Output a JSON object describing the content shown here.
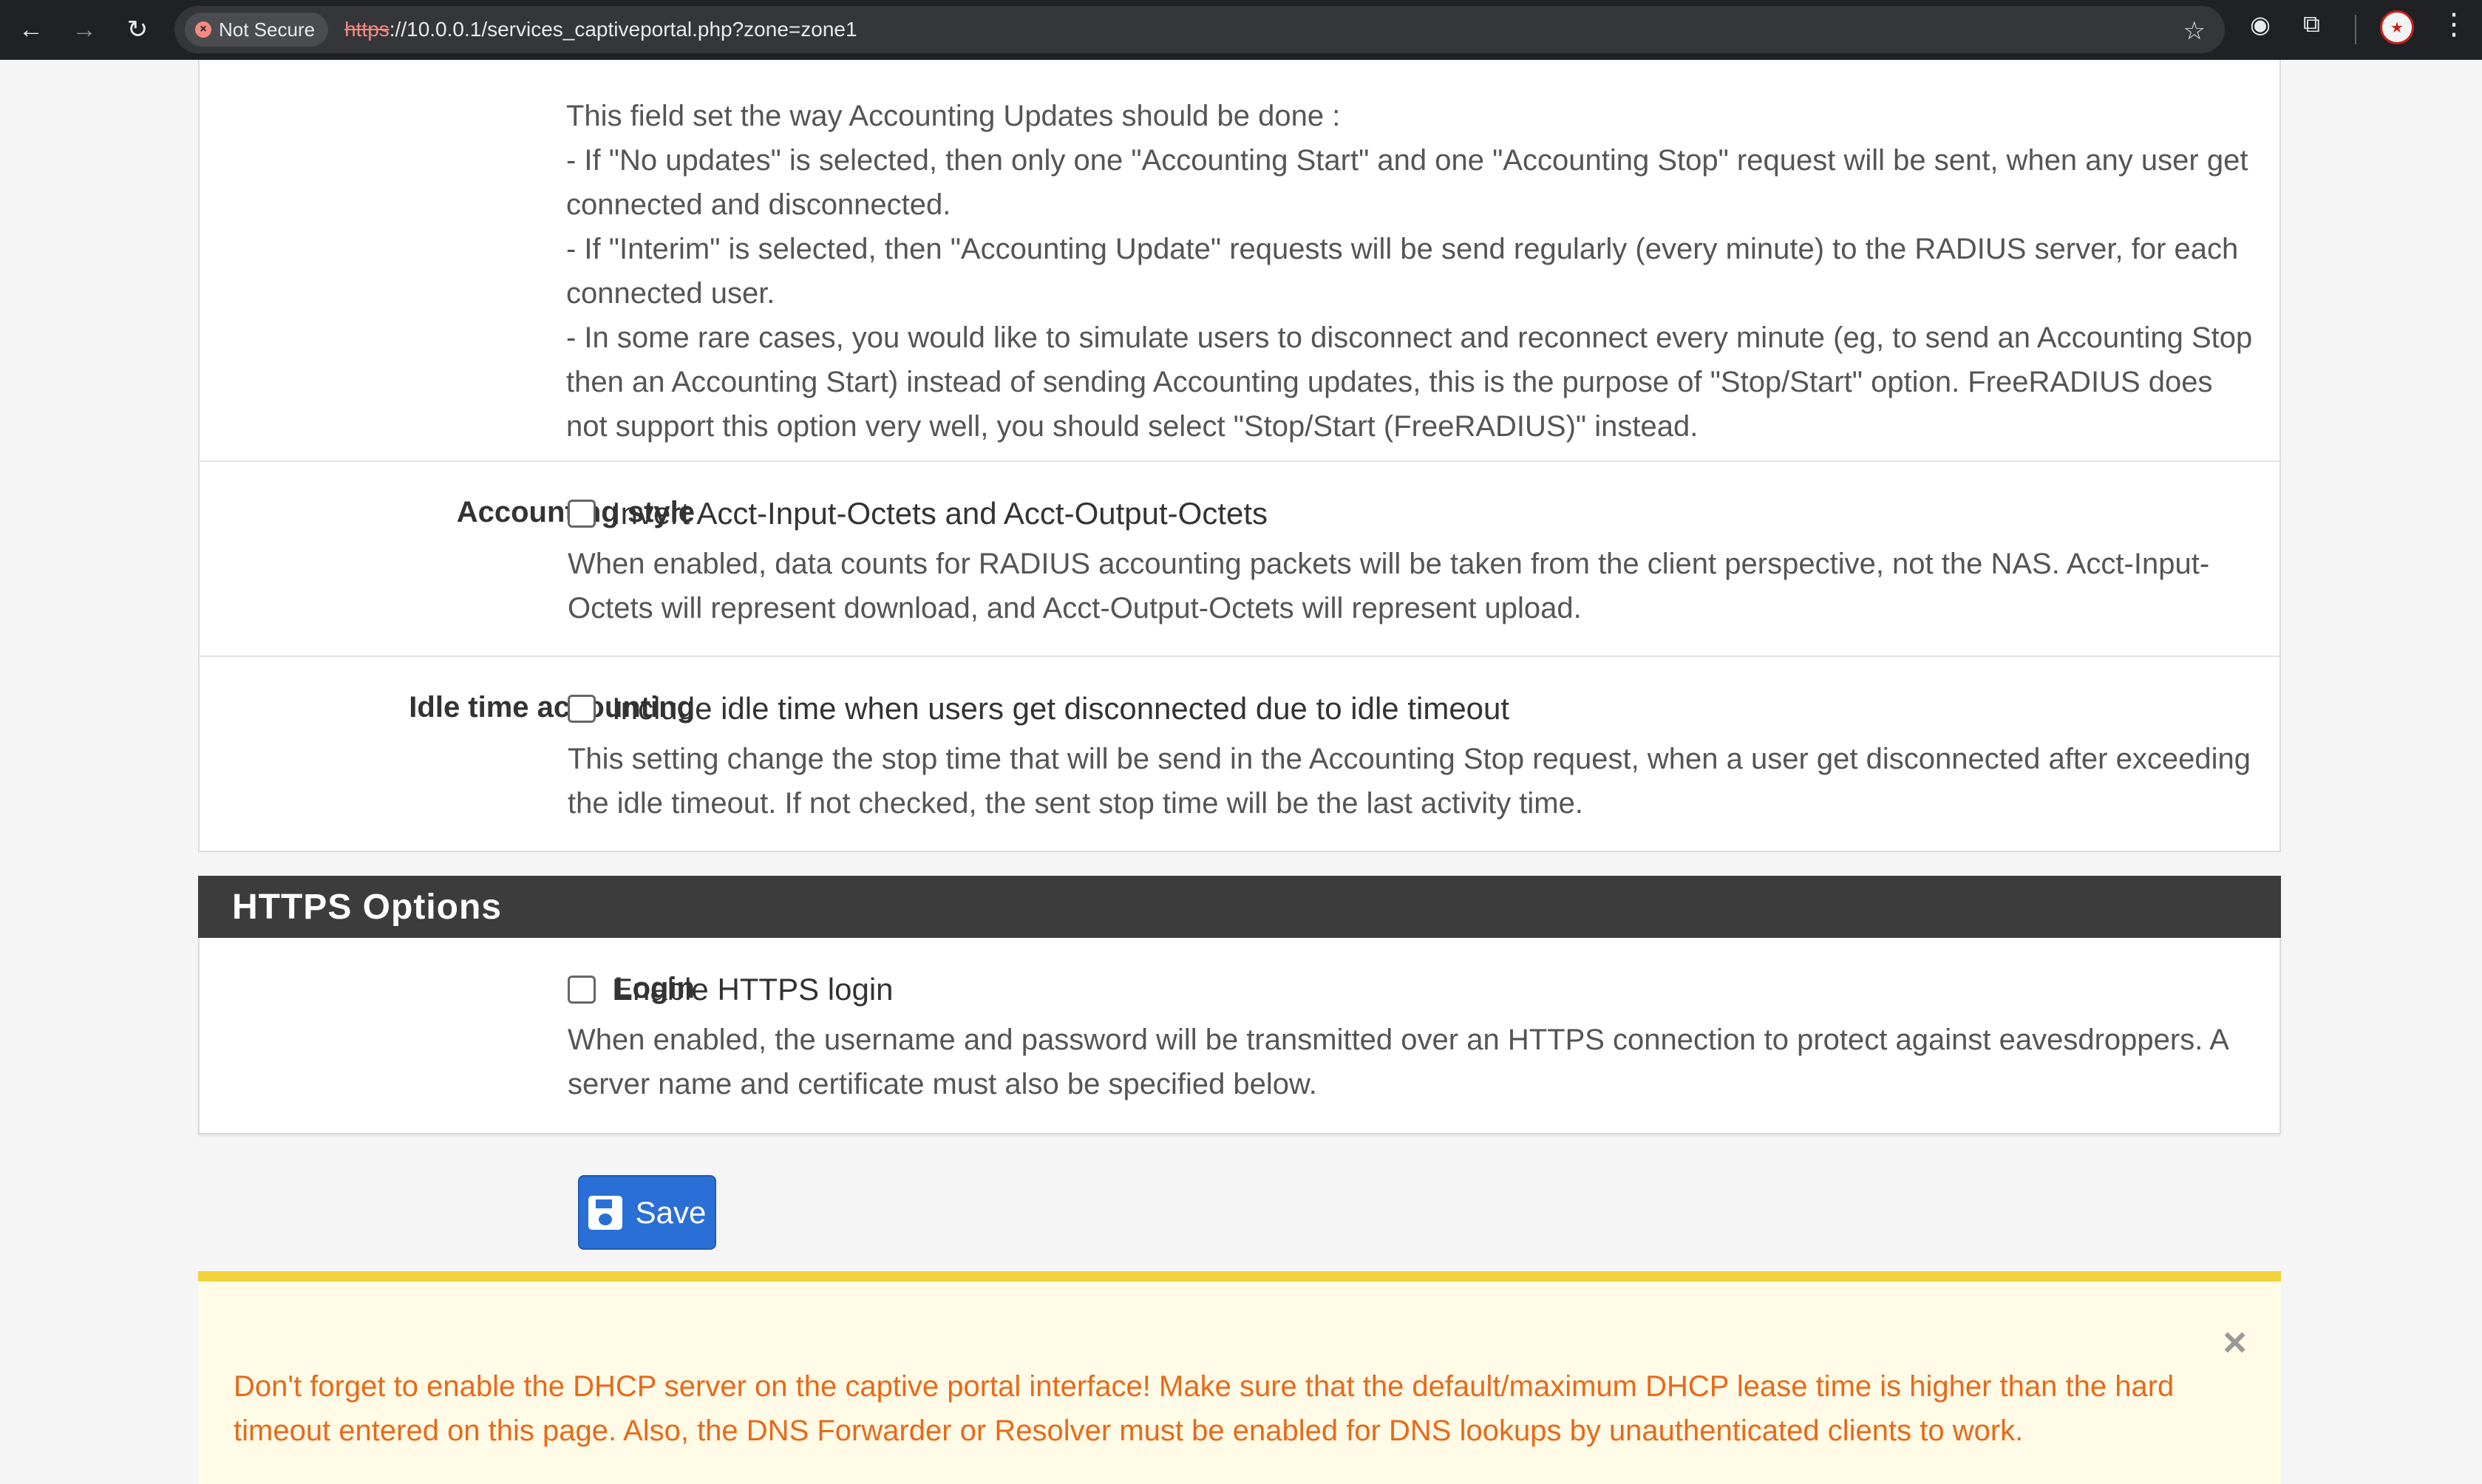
{
  "browser": {
    "security_chip": "Not Secure",
    "url_scheme": "https",
    "url_rest": "://10.0.0.1/services_captiveportal.php?zone=zone1"
  },
  "accounting_updates": {
    "help_lines": [
      "This field set the way Accounting Updates should be done :",
      "- If \"No updates\" is selected, then only one \"Accounting Start\" and one \"Accounting Stop\" request will be sent, when any user get connected and disconnected.",
      "- If \"Interim\" is selected, then \"Accounting Update\" requests will be send regularly (every minute) to the RADIUS server, for each connected user.",
      "- In some rare cases, you would like to simulate users to disconnect and reconnect every minute (eg, to send an Accounting Stop then an Accounting Start) instead of sending Accounting updates, this is the purpose of \"Stop/Start\" option. FreeRADIUS does not support this option very well, you should select \"Stop/Start (FreeRADIUS)\" instead."
    ]
  },
  "accounting_style": {
    "label": "Accounting style",
    "checkbox_label": "Invert Acct-Input-Octets and Acct-Output-Octets",
    "help": "When enabled, data counts for RADIUS accounting packets will be taken from the client perspective, not the NAS. Acct-Input-Octets will represent download, and Acct-Output-Octets will represent upload."
  },
  "idle_time": {
    "label": "Idle time accounting",
    "checkbox_label": "Include idle time when users get disconnected due to idle timeout",
    "help": "This setting change the stop time that will be send in the Accounting Stop request, when a user get disconnected after exceeding the idle timeout. If not checked, the sent stop time will be the last activity time."
  },
  "https_section": {
    "title": "HTTPS Options",
    "login_label": "Login",
    "checkbox_label": "Enable HTTPS login",
    "help": "When enabled, the username and password will be transmitted over an HTTPS connection to protect against eavesdroppers. A server name and certificate must also be specified below."
  },
  "save_label": "Save",
  "alert": {
    "close": "×",
    "text": "Don't forget to enable the DHCP server on the captive portal interface! Make sure that the default/maximum DHCP lease time is higher than the hard timeout entered on this page. Also, the DNS Forwarder or Resolver must be enabled for DNS lookups by unauthenticated clients to work."
  }
}
